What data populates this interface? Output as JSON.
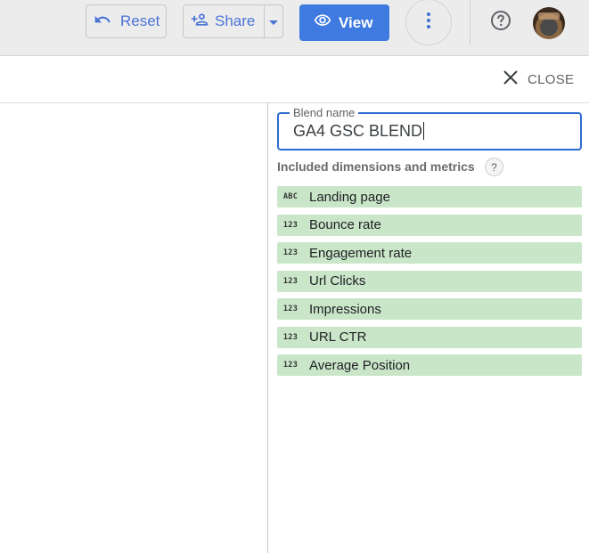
{
  "toolbar": {
    "reset_label": "Reset",
    "share_label": "Share",
    "view_label": "View"
  },
  "panel": {
    "close_label": "CLOSE"
  },
  "blend": {
    "name_legend": "Blend name",
    "name_value": "GA4 GSC BLEND",
    "included_label": "Included dimensions and metrics",
    "help_symbol": "?",
    "fields": [
      {
        "type": "ABC",
        "label": "Landing page"
      },
      {
        "type": "123",
        "label": "Bounce rate"
      },
      {
        "type": "123",
        "label": "Engagement rate"
      },
      {
        "type": "123",
        "label": "Url Clicks"
      },
      {
        "type": "123",
        "label": "Impressions"
      },
      {
        "type": "123",
        "label": "URL CTR"
      },
      {
        "type": "123",
        "label": "Average Position"
      }
    ]
  },
  "colors": {
    "accent": "#3f7ae0",
    "field_bg": "#c9e6c9",
    "field_focus": "#2f6bd1"
  },
  "icons": [
    "undo-icon",
    "person-add-icon",
    "chevron-down-icon",
    "eye-icon",
    "more-vert-icon",
    "help-icon",
    "close-icon"
  ]
}
